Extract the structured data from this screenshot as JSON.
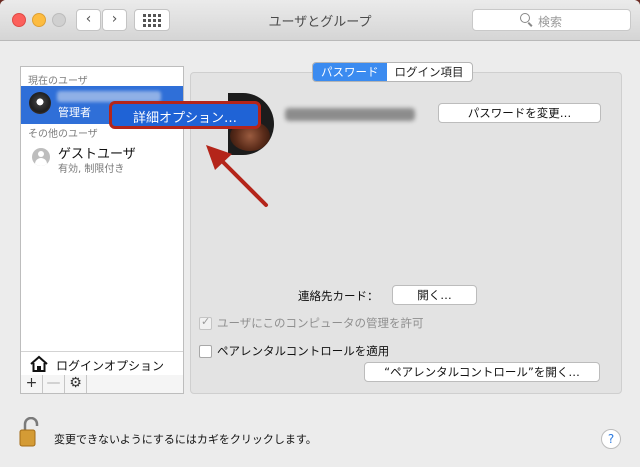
{
  "window": {
    "title": "ユーザとグループ"
  },
  "toolbar": {
    "back": "‹",
    "forward": "›",
    "search_placeholder": "検索"
  },
  "sidebar": {
    "current_header": "現在のユーザ",
    "current_user": {
      "role": "管理者"
    },
    "other_header": "その他のユーザ",
    "guest": {
      "name": "ゲストユーザ",
      "sub": "有効, 制限付き"
    },
    "login_options": "ログインオプション",
    "add": "+",
    "remove": "—",
    "gear": "⚙"
  },
  "context_menu": {
    "item": "詳細オプション…"
  },
  "tabs": [
    {
      "label": "パスワード",
      "selected": true
    },
    {
      "label": "ログイン項目",
      "selected": false
    }
  ],
  "main": {
    "change_password": "パスワードを変更…",
    "contact_card_label": "連絡先カード：",
    "open_button": "開く…",
    "allow_admin": {
      "label": "ユーザにこのコンピュータの管理を許可",
      "checked": true,
      "enabled": false
    },
    "parental": {
      "label": "ペアレンタルコントロールを適用",
      "checked": false
    },
    "open_parental": "“ペアレンタルコントロール”を開く…"
  },
  "footer": {
    "lock_note": "変更できないようにするにはカギをクリックします。",
    "help": "?"
  },
  "colors": {
    "accent": "#2f6fd8",
    "annotation": "#b4251a"
  }
}
